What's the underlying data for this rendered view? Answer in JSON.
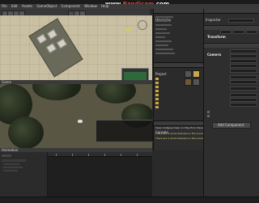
{
  "watermark": {
    "prefix": "www.",
    "brand": "Bandicam",
    "suffix": ".com"
  },
  "menu": [
    "File",
    "Edit",
    "Assets",
    "GameObject",
    "Component",
    "Window",
    "Help"
  ],
  "panels": {
    "scene_tab": "Scene",
    "game_tab": "Game",
    "animation_tab": "Animation",
    "hierarchy_tab": "Hierarchy",
    "project_tab": "Project",
    "console_tab": "Console",
    "inspector_tab": "Inspector"
  },
  "console": {
    "clear": "Clear",
    "collapse": "Collapse",
    "clear_on_play": "Clear on Play",
    "error_pause": "Error Pause",
    "messages": [
      "There are 2 audio listeners in the scene.",
      "There are 2 audio listeners in the scene."
    ]
  },
  "inspector": {
    "transform": "Transform",
    "camera": "Camera",
    "add_component": "Add Component"
  },
  "colors": {
    "accent": "#c9a646",
    "panel": "#2b2b2b",
    "scene_bg": "#c9c0a4"
  }
}
